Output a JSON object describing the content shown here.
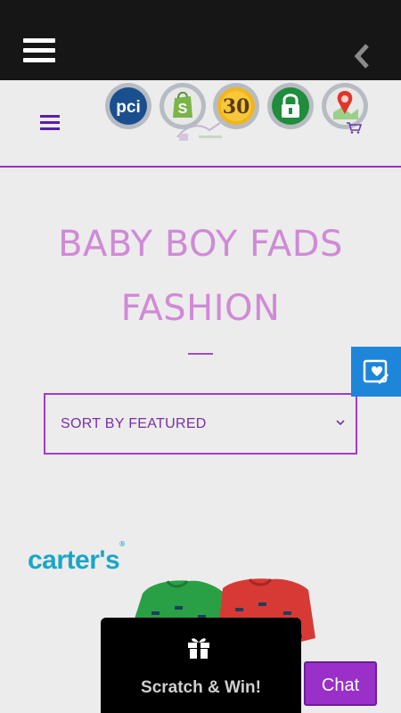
{
  "header": {
    "badges": [
      {
        "name": "pci-badge",
        "text": "pci"
      },
      {
        "name": "shopify-badge",
        "text": ""
      },
      {
        "name": "thirty-day-badge",
        "text": "30"
      },
      {
        "name": "secure-lock-badge",
        "text": ""
      },
      {
        "name": "location-badge",
        "text": ""
      }
    ]
  },
  "page": {
    "title_line1": "BABY BOY FADS",
    "title_line2": "FASHION"
  },
  "sort": {
    "label": "SORT BY FEATURED"
  },
  "product": {
    "brand": "carter's"
  },
  "widgets": {
    "scratch_label": "Scratch & Win!",
    "chat_label": "Chat"
  },
  "colors": {
    "topbar": "#161616",
    "accent": "#9b30c8",
    "title": "#d08ad6",
    "side_tab": "#1e86d8",
    "chat": "#9a30c8",
    "brand": "#1aa6c8"
  }
}
